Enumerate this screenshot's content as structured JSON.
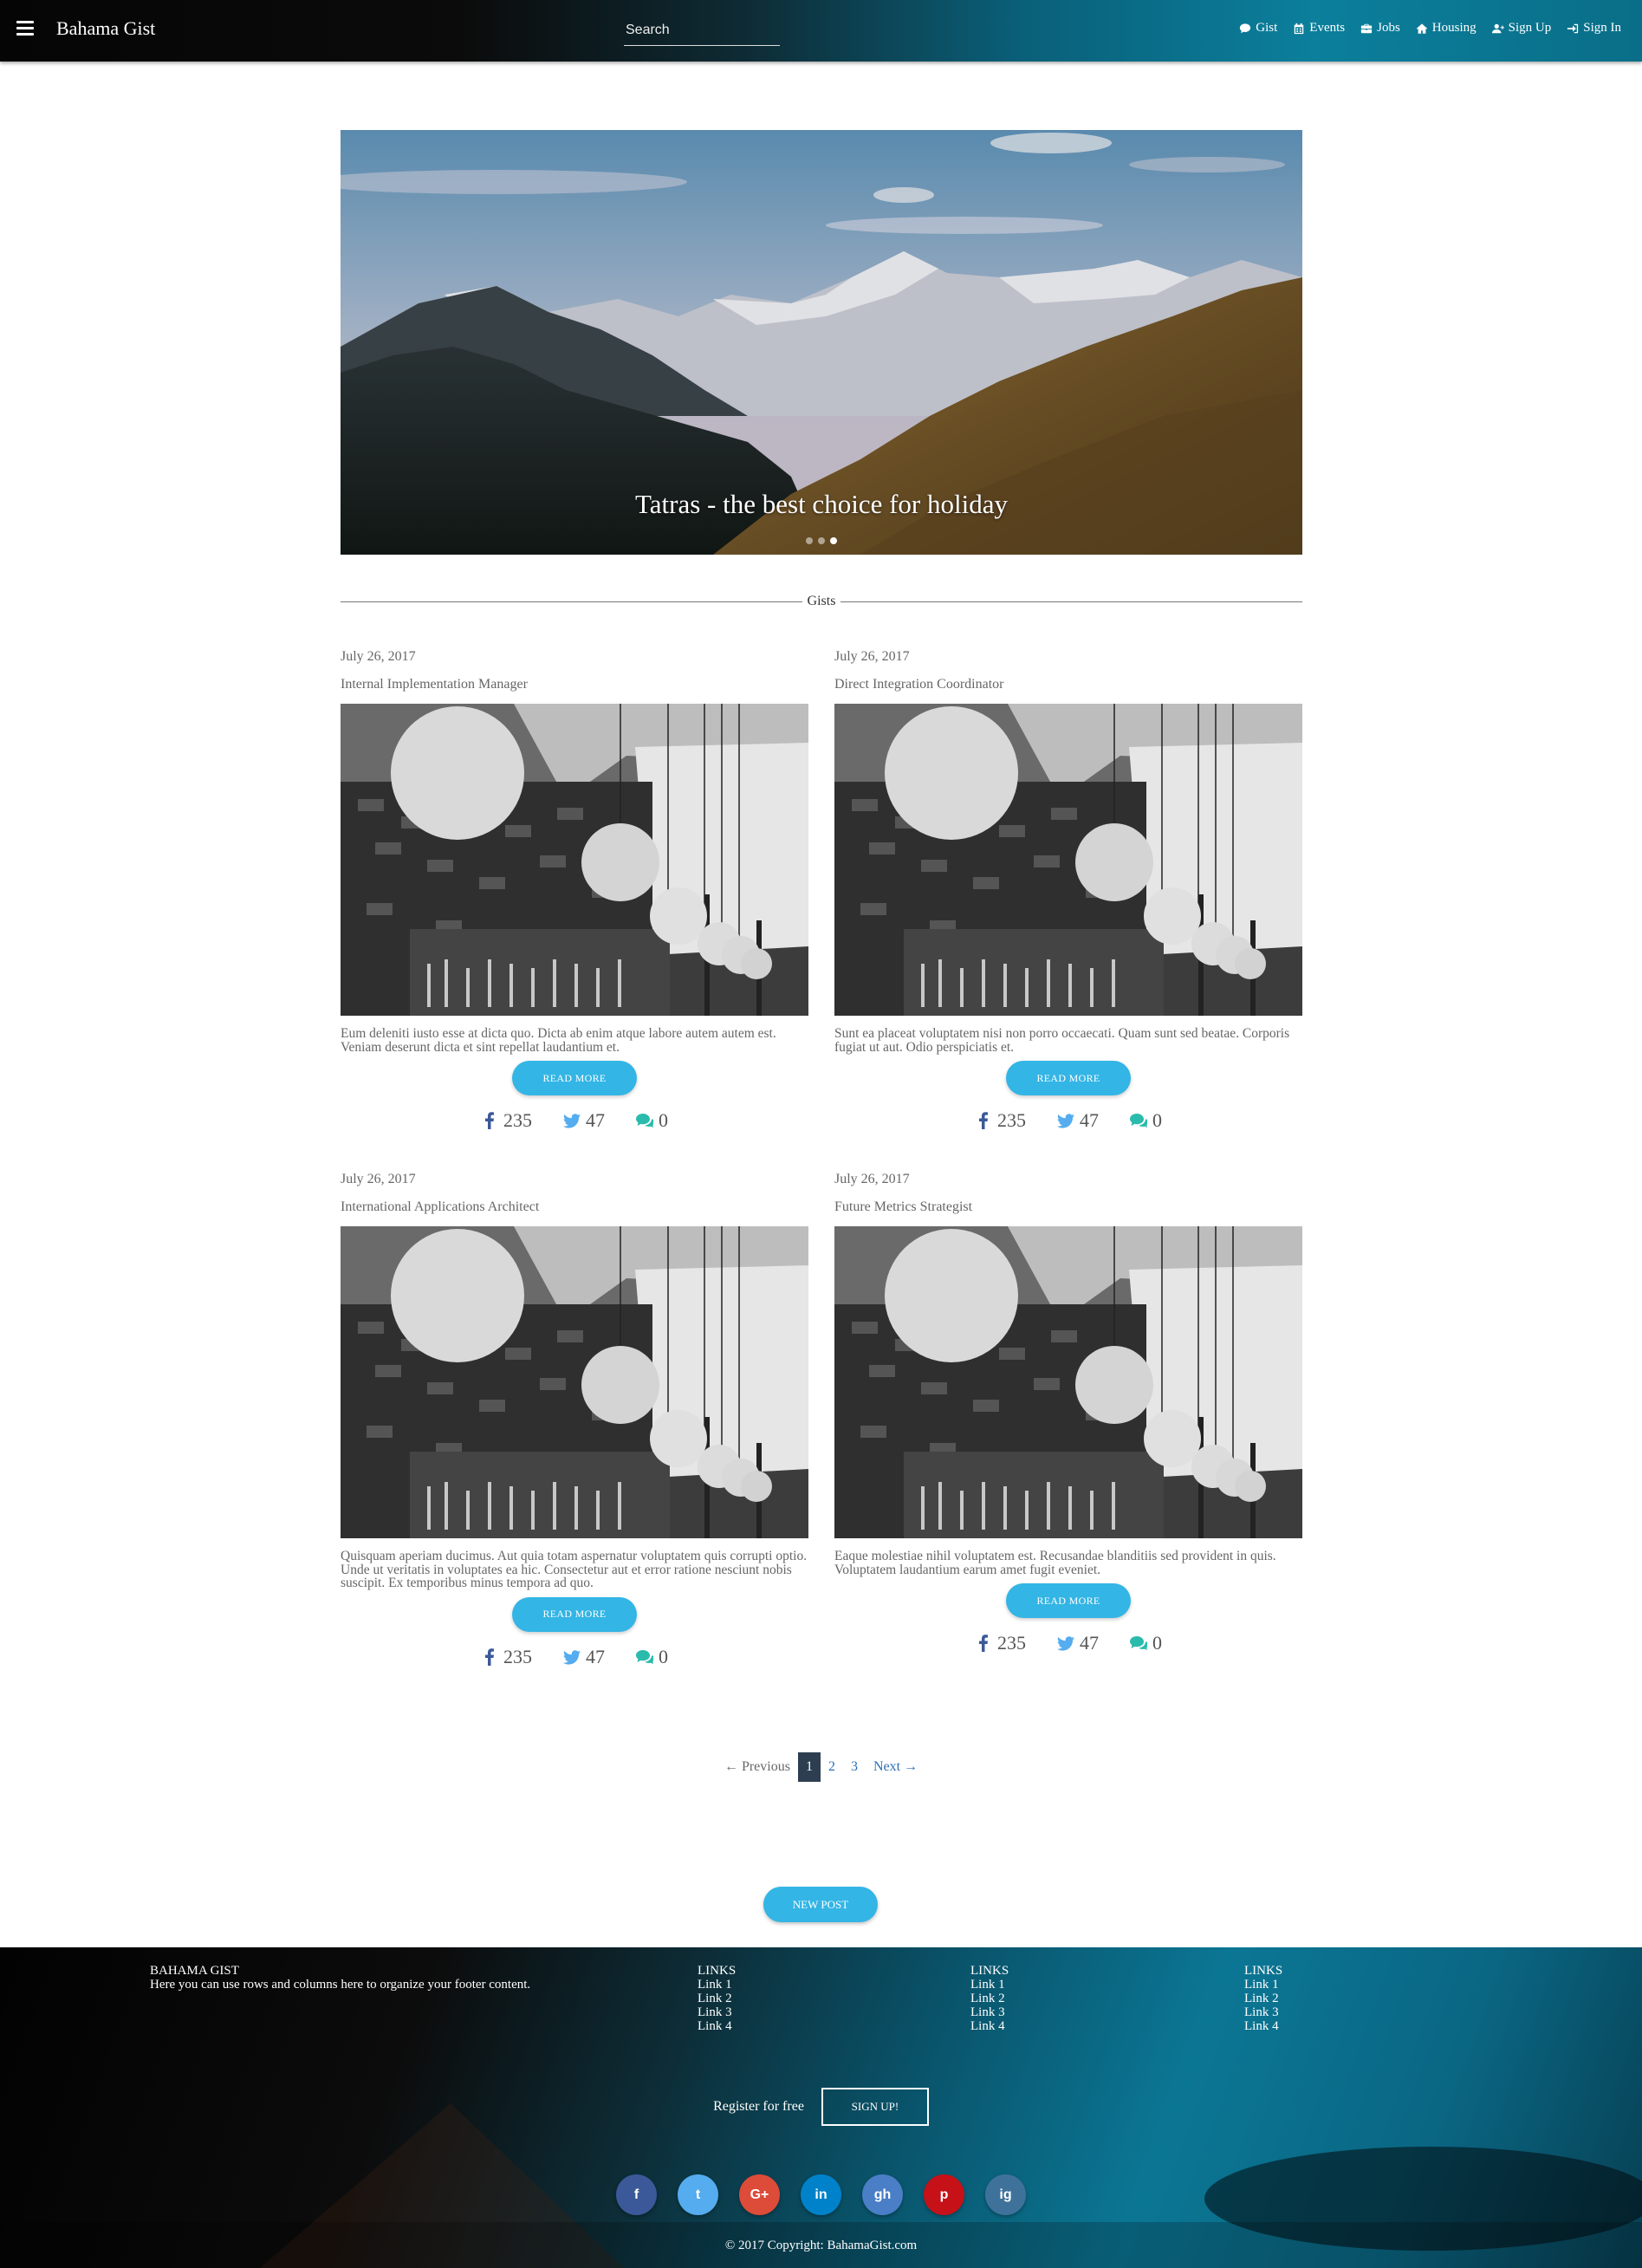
{
  "navbar": {
    "brand": "Bahama Gist",
    "search_placeholder": "Search",
    "links": [
      {
        "label": "Gist",
        "icon": "comment-icon"
      },
      {
        "label": "Events",
        "icon": "calendar-icon"
      },
      {
        "label": "Jobs",
        "icon": "briefcase-icon"
      },
      {
        "label": "Housing",
        "icon": "home-icon"
      },
      {
        "label": "Sign Up",
        "icon": "user-plus-icon"
      },
      {
        "label": "Sign In",
        "icon": "sign-in-icon"
      }
    ]
  },
  "hero": {
    "caption": "Tatras - the best choice for holiday",
    "slides": 3,
    "active_slide": 3
  },
  "section": {
    "title": "Gists"
  },
  "posts": [
    {
      "date": "July 26, 2017",
      "title": "Internal Implementation Manager",
      "excerpt": "Eum deleniti iusto esse at dicta quo. Dicta ab enim atque labore autem autem est. Veniam deserunt dicta et sint repellat laudantium et.",
      "button": "READ MORE",
      "facebook": "235",
      "twitter": "47",
      "comments": "0"
    },
    {
      "date": "July 26, 2017",
      "title": "Direct Integration Coordinator",
      "excerpt": "Sunt ea placeat voluptatem nisi non porro occaecati. Quam sunt sed beatae. Corporis fugiat ut aut. Odio perspiciatis et.",
      "button": "READ MORE",
      "facebook": "235",
      "twitter": "47",
      "comments": "0"
    },
    {
      "date": "July 26, 2017",
      "title": "International Applications Architect",
      "excerpt": "Quisquam aperiam ducimus. Aut quia totam aspernatur voluptatem quis corrupti optio. Unde ut veritatis in voluptates ea hic. Consectetur aut et error ratione nesciunt nobis suscipit. Ex temporibus minus tempora ad quo.",
      "button": "READ MORE",
      "facebook": "235",
      "twitter": "47",
      "comments": "0"
    },
    {
      "date": "July 26, 2017",
      "title": "Future Metrics Strategist",
      "excerpt": "Eaque molestiae nihil voluptatem est. Recusandae blanditiis sed provident in quis. Voluptatem laudantium earum amet fugit eveniet.",
      "button": "READ MORE",
      "facebook": "235",
      "twitter": "47",
      "comments": "0"
    }
  ],
  "pagination": {
    "previous": "← Previous",
    "pages": [
      "1",
      "2",
      "3"
    ],
    "current": "1",
    "next": "Next →"
  },
  "new_post_button": "NEW POST",
  "footer": {
    "about": {
      "title": "BAHAMA GIST",
      "text": "Here you can use rows and columns here to organize your footer content."
    },
    "link_columns": [
      {
        "title": "LINKS",
        "links": [
          "Link 1",
          "Link 2",
          "Link 3",
          "Link 4"
        ]
      },
      {
        "title": "LINKS",
        "links": [
          "Link 1",
          "Link 2",
          "Link 3",
          "Link 4"
        ]
      },
      {
        "title": "LINKS",
        "links": [
          "Link 1",
          "Link 2",
          "Link 3",
          "Link 4"
        ]
      }
    ],
    "register_text": "Register for free",
    "signup_button": "SIGN UP!",
    "socials": [
      {
        "name": "facebook",
        "glyph": "f",
        "color": "#3b5998"
      },
      {
        "name": "twitter",
        "glyph": "t",
        "color": "#55acee"
      },
      {
        "name": "google-plus",
        "glyph": "G+",
        "color": "#dd4b39"
      },
      {
        "name": "linkedin",
        "glyph": "in",
        "color": "#0082ca"
      },
      {
        "name": "github",
        "glyph": "gh",
        "color": "#4a7ec6"
      },
      {
        "name": "pinterest",
        "glyph": "p",
        "color": "#c61118"
      },
      {
        "name": "instagram",
        "glyph": "ig",
        "color": "#3f729b"
      }
    ],
    "copyright": "© 2017 Copyright: BahamaGist.com"
  },
  "colors": {
    "accent": "#33b5e5",
    "pagination_active": "#2d3e50",
    "link": "#2a6fb5",
    "facebook_icon": "#3b5998",
    "twitter_icon": "#55acee",
    "comment_icon": "#2bbbad"
  }
}
